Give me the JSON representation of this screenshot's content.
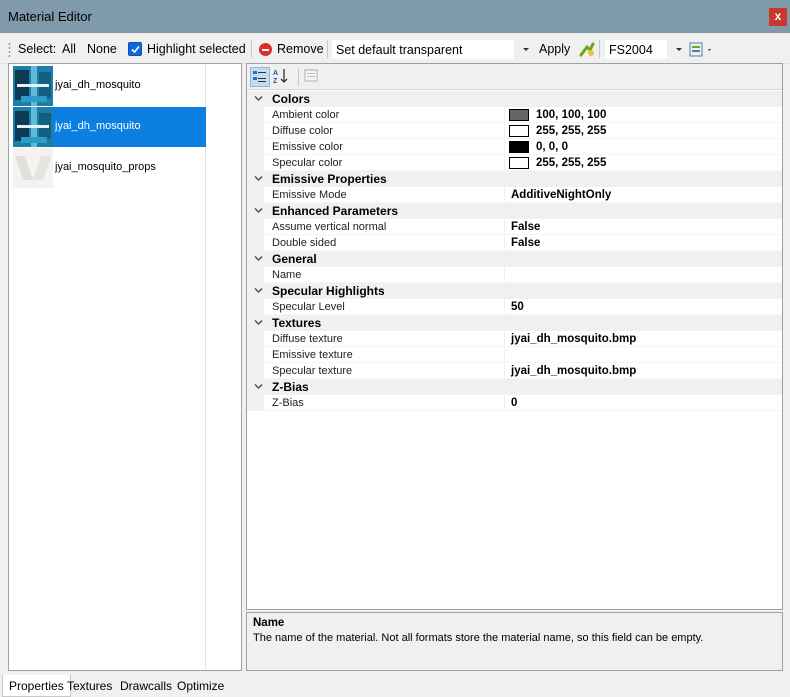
{
  "window": {
    "title": "Material Editor",
    "close_label": "x"
  },
  "toolbar": {
    "select_label": "Select:",
    "all_label": "All",
    "none_label": "None",
    "highlight_label": "Highlight selected",
    "highlight_checked": true,
    "remove_label": "Remove",
    "preset_value": "Set default transparent",
    "apply_label": "Apply",
    "format_value": "FS2004"
  },
  "materials": [
    {
      "name": "jyai_dh_mosquito",
      "selected": false,
      "thumb": "mosquito-texture"
    },
    {
      "name": "jyai_dh_mosquito",
      "selected": true,
      "thumb": "mosquito-texture"
    },
    {
      "name": "jyai_mosquito_props",
      "selected": false,
      "thumb": "props-texture"
    }
  ],
  "grid": {
    "categories": [
      {
        "name": "Colors",
        "props": [
          {
            "name": "Ambient color",
            "value": "100, 100, 100",
            "swatch": "#646464"
          },
          {
            "name": "Diffuse color",
            "value": "255, 255, 255",
            "swatch": "#ffffff"
          },
          {
            "name": "Emissive color",
            "value": "0, 0, 0",
            "swatch": "#000000"
          },
          {
            "name": "Specular color",
            "value": "255, 255, 255",
            "swatch": "#ffffff"
          }
        ]
      },
      {
        "name": "Emissive Properties",
        "props": [
          {
            "name": "Emissive Mode",
            "value": "AdditiveNightOnly"
          }
        ]
      },
      {
        "name": "Enhanced Parameters",
        "props": [
          {
            "name": "Assume vertical normal",
            "value": "False"
          },
          {
            "name": "Double sided",
            "value": "False"
          }
        ]
      },
      {
        "name": "General",
        "props": [
          {
            "name": "Name",
            "value": ""
          }
        ]
      },
      {
        "name": "Specular Highlights",
        "props": [
          {
            "name": "Specular Level",
            "value": "50"
          }
        ]
      },
      {
        "name": "Textures",
        "props": [
          {
            "name": "Diffuse texture",
            "value": "jyai_dh_mosquito.bmp"
          },
          {
            "name": "Emissive texture",
            "value": ""
          },
          {
            "name": "Specular texture",
            "value": "jyai_dh_mosquito.bmp"
          }
        ]
      },
      {
        "name": "Z-Bias",
        "props": [
          {
            "name": "Z-Bias",
            "value": "0"
          }
        ]
      }
    ]
  },
  "description": {
    "title": "Name",
    "text": "The name of the material. Not all formats store the material name, so this field can be empty."
  },
  "tabs": [
    {
      "label": "Properties",
      "active": true
    },
    {
      "label": "Textures",
      "active": false
    },
    {
      "label": "Drawcalls",
      "active": false
    },
    {
      "label": "Optimize",
      "active": false
    }
  ],
  "colors": {
    "titlebar": "#7f9aab",
    "selection": "#0d7fe0",
    "close": "#c8392b"
  }
}
